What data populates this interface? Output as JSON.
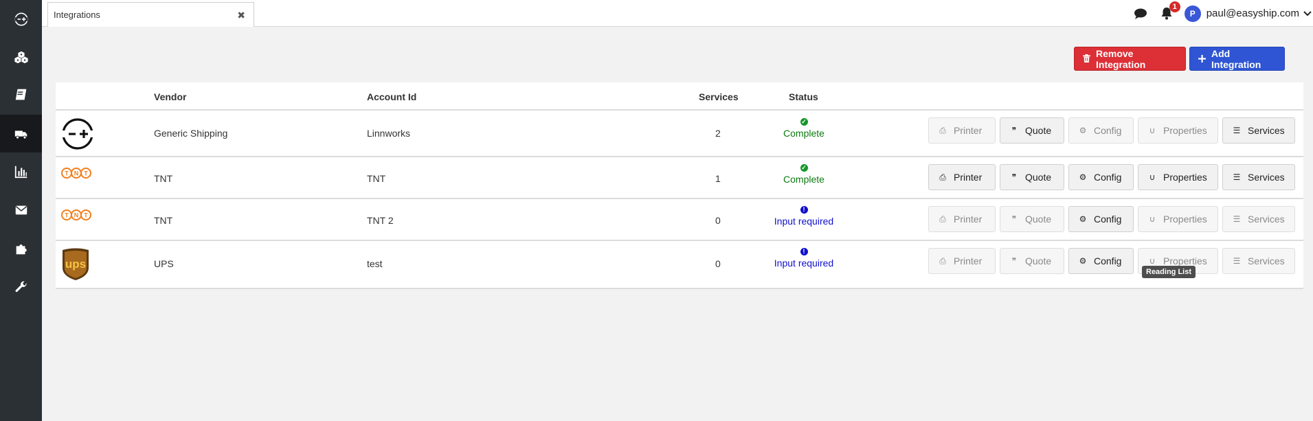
{
  "sidebar": {
    "items": [
      {
        "name": "logo-icon"
      },
      {
        "name": "boxes-icon"
      },
      {
        "name": "book-icon"
      },
      {
        "name": "truck-icon",
        "active": true
      },
      {
        "name": "chart-icon"
      },
      {
        "name": "envelope-icon"
      },
      {
        "name": "puzzle-icon"
      },
      {
        "name": "wrench-icon"
      }
    ]
  },
  "tabs": [
    {
      "label": "Integrations",
      "close": "✖"
    }
  ],
  "header": {
    "notification_count": "1",
    "avatar_initial": "P",
    "user_email": "paul@easyship.com"
  },
  "actions": {
    "remove_label": "Remove Integration",
    "add_label": "Add Integration"
  },
  "table": {
    "columns": {
      "vendor": "Vendor",
      "account_id": "Account Id",
      "services": "Services",
      "status": "Status"
    },
    "rows": [
      {
        "logo": "generic-shipping-logo",
        "vendor": "Generic Shipping",
        "account_id": "Linnworks",
        "services": "2",
        "status": "Complete",
        "status_type": "complete",
        "buttons": {
          "printer": false,
          "quote": true,
          "config": false,
          "properties": false,
          "services": true
        }
      },
      {
        "logo": "tnt-logo",
        "vendor": "TNT",
        "account_id": "TNT",
        "services": "1",
        "status": "Complete",
        "status_type": "complete",
        "buttons": {
          "printer": true,
          "quote": true,
          "config": true,
          "properties": true,
          "services": true
        }
      },
      {
        "logo": "tnt-logo",
        "vendor": "TNT",
        "account_id": "TNT 2",
        "services": "0",
        "status": "Input required",
        "status_type": "required",
        "buttons": {
          "printer": false,
          "quote": false,
          "config": true,
          "properties": false,
          "services": false
        }
      },
      {
        "logo": "ups-logo",
        "vendor": "UPS",
        "account_id": "test",
        "services": "0",
        "status": "Input required",
        "status_type": "required",
        "buttons": {
          "printer": false,
          "quote": false,
          "config": true,
          "properties": false,
          "services": false
        }
      }
    ],
    "button_labels": {
      "printer": "Printer",
      "quote": "Quote",
      "config": "Config",
      "properties": "Properties",
      "services": "Services"
    }
  },
  "tooltip": {
    "text": "Reading List"
  },
  "colors": {
    "sidebar_bg": "#2b3035",
    "remove_button": "#dc2f36",
    "add_button": "#2f55d4",
    "status_complete": "#0c7a12",
    "status_required": "#1010cc"
  }
}
